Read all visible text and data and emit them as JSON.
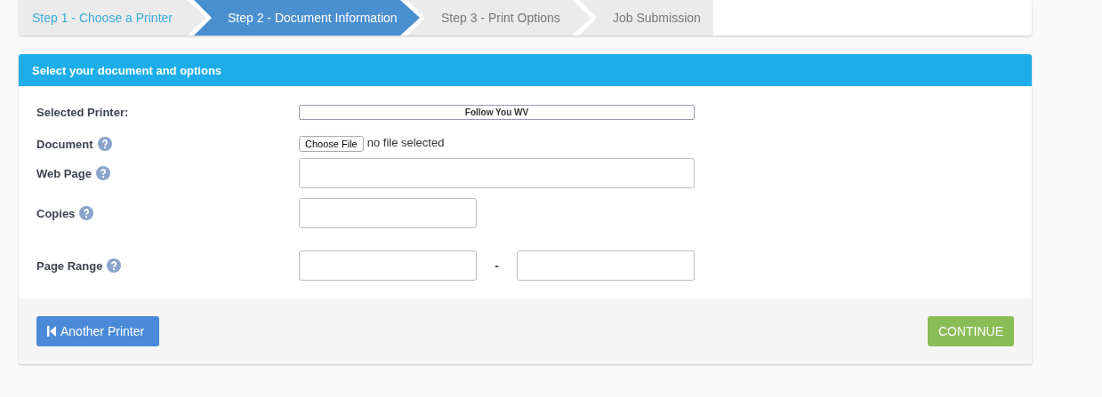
{
  "wizard_steps": [
    {
      "label": "Step 1 - Choose a Printer",
      "selected": false,
      "completed": true
    },
    {
      "label": "Step 2 - Document Information",
      "selected": true,
      "completed": false
    },
    {
      "label": "Step 3 - Print Options",
      "selected": false,
      "completed": false
    },
    {
      "label": "Job Submission",
      "selected": false,
      "completed": false
    }
  ],
  "panel": {
    "title": "Select your document and options",
    "fields": [
      {
        "kind": "display",
        "label": "Selected Printer:",
        "help": false,
        "value": "Follow You WV"
      },
      {
        "kind": "file",
        "label": "Document",
        "help": true,
        "button": "Choose File",
        "status": "no file selected"
      },
      {
        "kind": "text",
        "label": "Web Page",
        "help": true
      },
      {
        "kind": "short",
        "label": "Copies",
        "help": true
      },
      {
        "kind": "range",
        "label": "Page Range",
        "help": true,
        "separator": "-"
      }
    ],
    "buttons": [
      {
        "kind": "back",
        "label": "Another Printer"
      },
      {
        "kind": "next",
        "label": "CONTINUE"
      }
    ]
  }
}
